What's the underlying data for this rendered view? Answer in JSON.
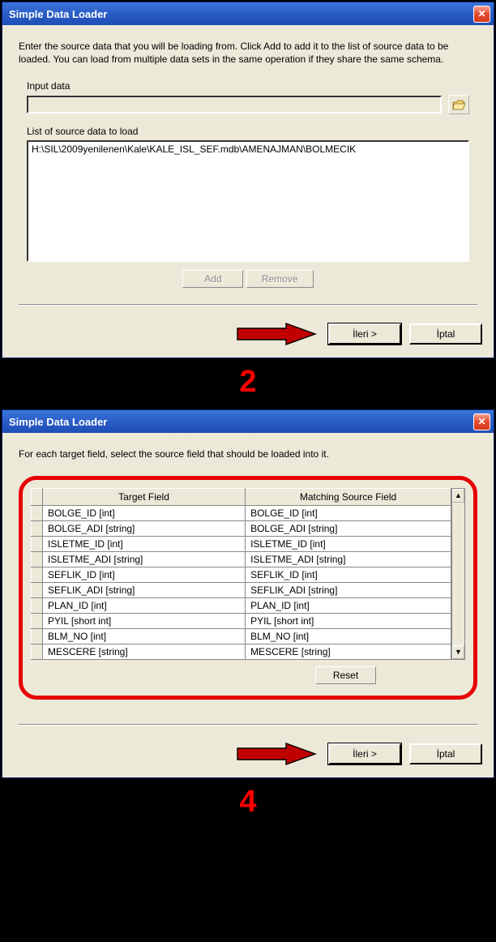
{
  "dialog1": {
    "title": "Simple Data Loader",
    "instruction": "Enter the source data that you will be loading from. Click Add to add it to the list of source data to be loaded. You can load from multiple data sets in the same operation if they share the same schema.",
    "input_data_label": "Input data",
    "list_label": "List of source data to load",
    "source_item": "H:\\SIL\\2009yenilenen\\Kale\\KALE_ISL_SEF.mdb\\AMENAJMAN\\BOLMECIK",
    "add_label": "Add",
    "remove_label": "Remove",
    "next_label": "İleri >",
    "cancel_label": "İptal"
  },
  "step_a": "2",
  "dialog2": {
    "title": "Simple Data Loader",
    "instruction": "For each target field, select the source field that should be loaded into it.",
    "col_target": "Target Field",
    "col_source": "Matching Source Field",
    "rows": [
      {
        "t": "BOLGE_ID [int]",
        "s": "BOLGE_ID [int]"
      },
      {
        "t": "BOLGE_ADI [string]",
        "s": "BOLGE_ADI [string]"
      },
      {
        "t": "ISLETME_ID [int]",
        "s": "ISLETME_ID [int]"
      },
      {
        "t": "ISLETME_ADI [string]",
        "s": "ISLETME_ADI [string]"
      },
      {
        "t": "SEFLIK_ID [int]",
        "s": "SEFLIK_ID [int]"
      },
      {
        "t": "SEFLIK_ADI [string]",
        "s": "SEFLIK_ADI [string]"
      },
      {
        "t": "PLAN_ID [int]",
        "s": "PLAN_ID [int]"
      },
      {
        "t": "PYIL [short int]",
        "s": "PYIL [short int]"
      },
      {
        "t": "BLM_NO [int]",
        "s": "BLM_NO [int]"
      },
      {
        "t": "MESCERE [string]",
        "s": "MESCERE [string]"
      }
    ],
    "reset_label": "Reset",
    "next_label": "İleri >",
    "cancel_label": "İptal"
  },
  "step_b": "4"
}
